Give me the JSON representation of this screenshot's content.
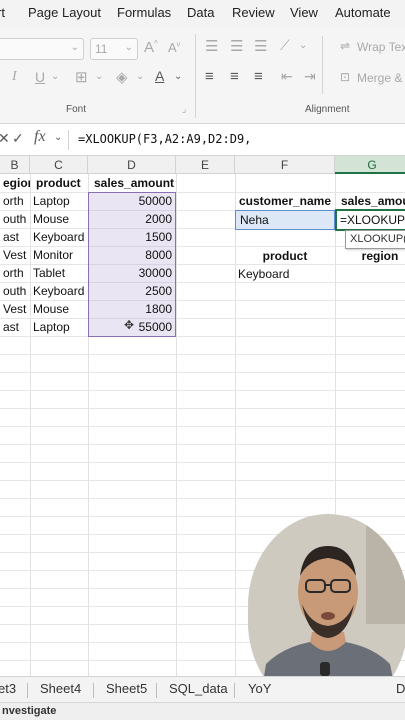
{
  "menu": [
    "rt",
    "Page Layout",
    "Formulas",
    "Data",
    "Review",
    "View",
    "Automate"
  ],
  "ribbon": {
    "font_size": "11",
    "wrap_text_label": "Wrap Text",
    "merge_label": "Merge &",
    "font_group_label": "Font",
    "alignment_group_label": "Alignment"
  },
  "formula_bar": {
    "fx_label": "fx",
    "formula": "=XLOOKUP(F3,A2:A9,D2:D9,"
  },
  "grid": {
    "columns": [
      "B",
      "C",
      "D",
      "E",
      "F",
      "G"
    ],
    "active_column": "G",
    "header_row": {
      "region": "egion",
      "product": "product",
      "sales_amount": "sales_amount"
    },
    "rows": [
      {
        "region": "orth",
        "product": "Laptop",
        "amount": "50000"
      },
      {
        "region": "outh",
        "product": "Mouse",
        "amount": "2000"
      },
      {
        "region": "ast",
        "product": "Keyboard",
        "amount": "1500"
      },
      {
        "region": "Vest",
        "product": "Monitor",
        "amount": "8000"
      },
      {
        "region": "orth",
        "product": "Tablet",
        "amount": "30000"
      },
      {
        "region": "outh",
        "product": "Keyboard",
        "amount": "2500"
      },
      {
        "region": "Vest",
        "product": "Mouse",
        "amount": "1800"
      },
      {
        "region": "ast",
        "product": "Laptop",
        "amount": "55000"
      }
    ],
    "lookup": {
      "customer_name_header": "customer_name",
      "sales_amount_header": "sales_amou",
      "customer_value": "Neha",
      "formula_in_cell": "=XLOOKUP(",
      "tooltip": "XLOOKUP(",
      "product_header": "product",
      "region_header": "region",
      "product_value": "Keyboard"
    }
  },
  "sheet_tabs": [
    "et3",
    "Sheet4",
    "Sheet5",
    "SQL_data",
    "YoY",
    "D"
  ],
  "status": "nvestigate",
  "colors": {
    "excel_green": "#217346",
    "selection_purple": "#8a6fb5",
    "selected_cell_blue": "#5b8fd6"
  }
}
